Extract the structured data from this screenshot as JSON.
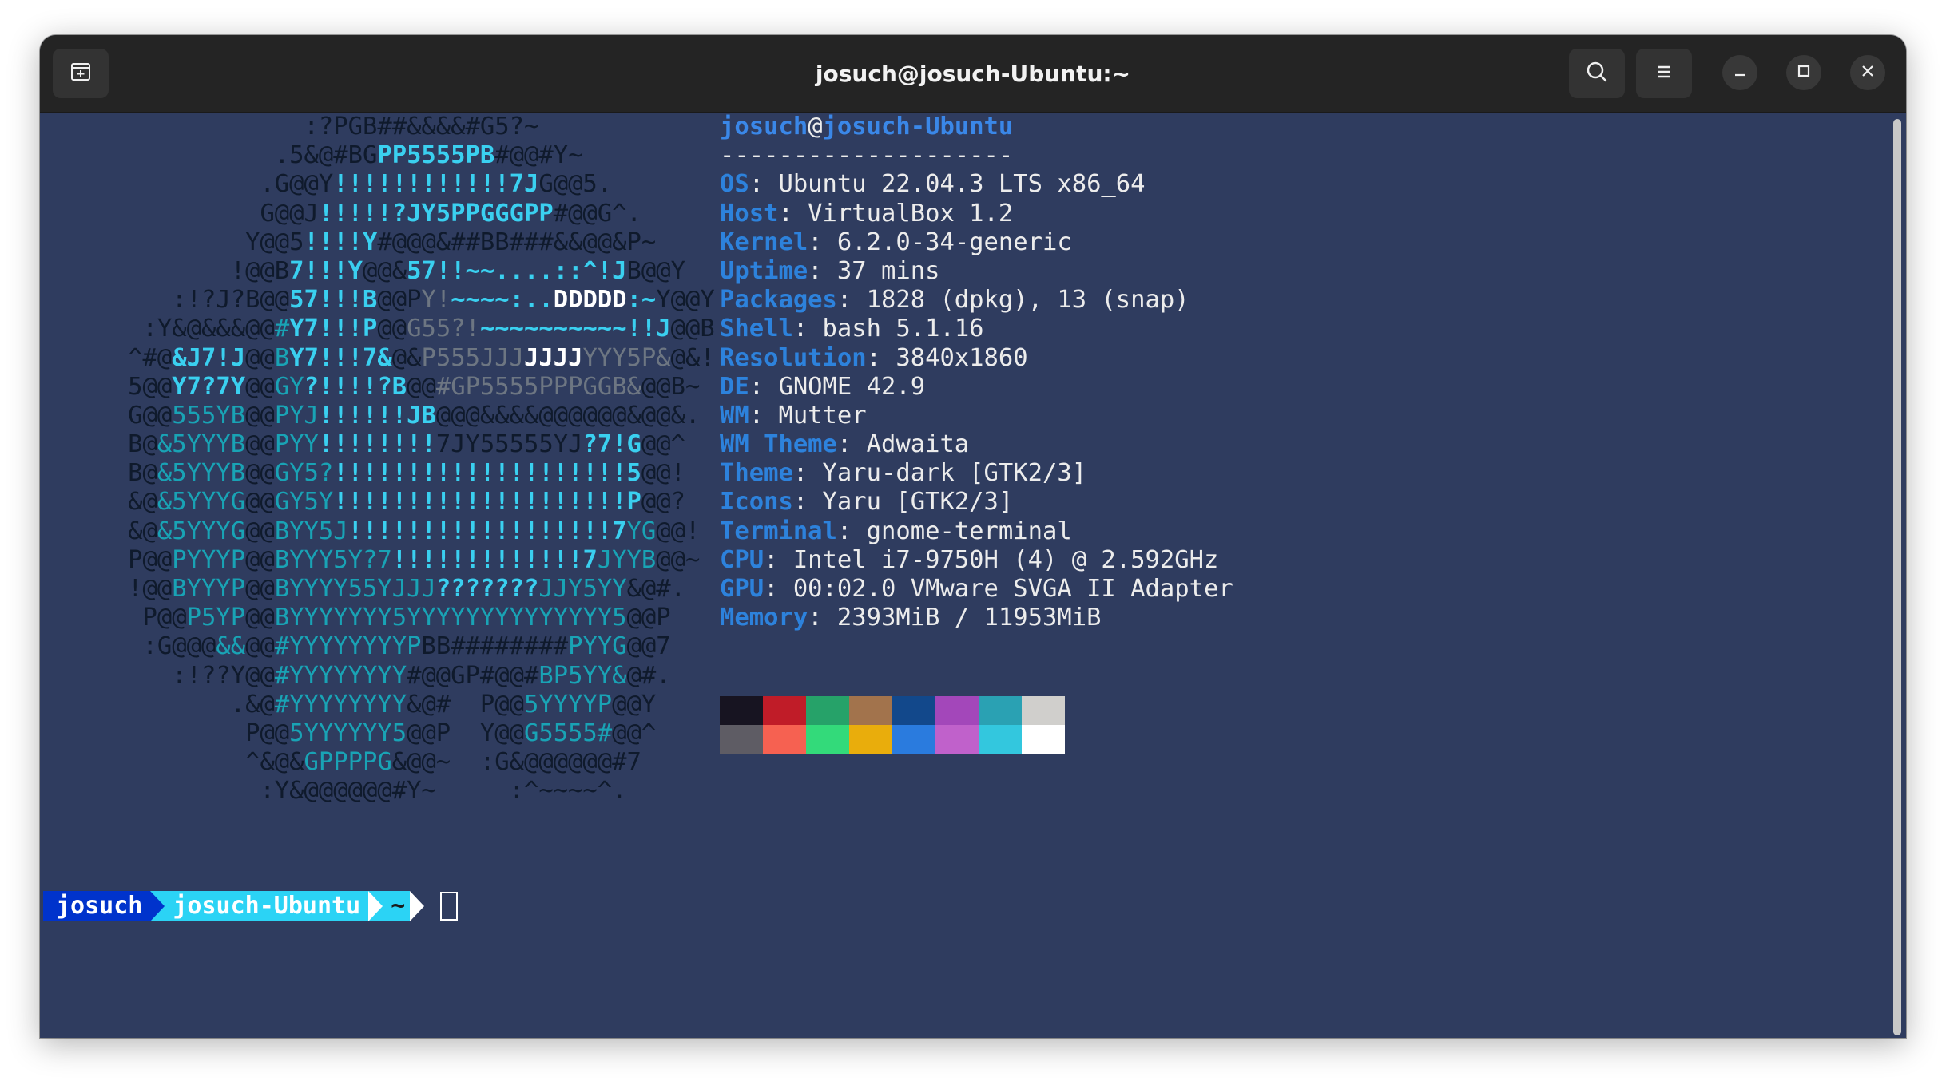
{
  "window": {
    "title": "josuch@josuch-Ubuntu:~",
    "buttons": {
      "new_tab_icon": "new-tab-icon",
      "search_icon": "search-icon",
      "menu_icon": "hamburger-menu-icon",
      "minimize_icon": "minimize-icon",
      "maximize_icon": "maximize-icon",
      "close_icon": "close-icon"
    }
  },
  "colors": {
    "terminal_bg": "#2f3c5f",
    "titlebar_bg": "#242424",
    "key_color": "#2d82dc",
    "art_cyan": "#3ad0f0",
    "art_teal": "#19a3b5"
  },
  "art": [
    [
      [
        "d",
        "                  :?PGB##&&&&#G5?~"
      ]
    ],
    [
      [
        "d",
        "                .5&@#BG"
      ],
      [
        "c",
        "PP5555PB"
      ],
      [
        "d",
        "#@@#Y~"
      ]
    ],
    [
      [
        "d",
        "               .G@@Y"
      ],
      [
        "c",
        "!!!!!!!!!!!!7J"
      ],
      [
        "d",
        "G@@5."
      ]
    ],
    [
      [
        "d",
        "               G@@J"
      ],
      [
        "c",
        "!!!!!?JY5PPGGGPP"
      ],
      [
        "d",
        "#@@G^."
      ]
    ],
    [
      [
        "d",
        "              Y@@5"
      ],
      [
        "c",
        "!!!!Y"
      ],
      [
        "d",
        "#@@@&##BB###&&@@&P~"
      ]
    ],
    [
      [
        "d",
        "             !@@B"
      ],
      [
        "c",
        "7!!!Y"
      ],
      [
        "d",
        "@@&"
      ],
      [
        "c",
        "57!!~~....::^!J"
      ],
      [
        "d",
        "B@@Y"
      ]
    ],
    [
      [
        "d",
        "         :!?J?B@@"
      ],
      [
        "c",
        "57!!!B"
      ],
      [
        "d",
        "@@P"
      ],
      [
        "g",
        "Y!"
      ],
      [
        "c",
        "~~~~:.."
      ],
      [
        "w",
        "DDDDD"
      ],
      [
        "c",
        ":~"
      ],
      [
        "d",
        "Y@@Y"
      ]
    ],
    [
      [
        "d",
        "       :Y&@&&&@@"
      ],
      [
        "t",
        "#"
      ],
      [
        "c",
        "Y7!!!P"
      ],
      [
        "d",
        "@@"
      ],
      [
        "g",
        "G55?!"
      ],
      [
        "c",
        "~~~~~~~~~~!!J"
      ],
      [
        "d",
        "@@B"
      ]
    ],
    [
      [
        "d",
        "      ^#@"
      ],
      [
        "c",
        "&J7!J"
      ],
      [
        "d",
        "@@"
      ],
      [
        "t",
        "B"
      ],
      [
        "c",
        "Y7!!!7&"
      ],
      [
        "d",
        "@&"
      ],
      [
        "g",
        "P555JJJ"
      ],
      [
        "w",
        "JJJJ"
      ],
      [
        "g",
        "YYY5P&"
      ],
      [
        "d",
        "@&!"
      ]
    ],
    [
      [
        "d",
        "      5@@"
      ],
      [
        "c",
        "Y7?7Y"
      ],
      [
        "d",
        "@@"
      ],
      [
        "t",
        "GY"
      ],
      [
        "c",
        "?!!!!?B"
      ],
      [
        "d",
        "@@"
      ],
      [
        "g",
        "#GP5555PPPGGB&"
      ],
      [
        "d",
        "@@B~"
      ]
    ],
    [
      [
        "d",
        "      G@@"
      ],
      [
        "t",
        "555YB"
      ],
      [
        "d",
        "@@"
      ],
      [
        "t",
        "PYJ"
      ],
      [
        "c",
        "!!!!!!JB"
      ],
      [
        "d",
        "@@@&&&&@@@@@@&@@&."
      ]
    ],
    [
      [
        "d",
        "      B@"
      ],
      [
        "t",
        "&5YYYB"
      ],
      [
        "d",
        "@@"
      ],
      [
        "t",
        "PYY"
      ],
      [
        "c",
        "!!!!!!!!"
      ],
      [
        "d",
        "7JY55555YJ"
      ],
      [
        "c",
        "?7!G"
      ],
      [
        "d",
        "@@^"
      ]
    ],
    [
      [
        "d",
        "      B@"
      ],
      [
        "t",
        "&5YYYB"
      ],
      [
        "d",
        "@@"
      ],
      [
        "t",
        "GY5?"
      ],
      [
        "c",
        "!!!!!!!!!!!!!!!!!!!!5"
      ],
      [
        "d",
        "@@!"
      ]
    ],
    [
      [
        "d",
        "      &@"
      ],
      [
        "t",
        "&5YYYG"
      ],
      [
        "d",
        "@@"
      ],
      [
        "t",
        "GY5Y"
      ],
      [
        "c",
        "!!!!!!!!!!!!!!!!!!!!P"
      ],
      [
        "d",
        "@@?"
      ]
    ],
    [
      [
        "d",
        "      &@"
      ],
      [
        "t",
        "&5YYYG"
      ],
      [
        "d",
        "@@"
      ],
      [
        "t",
        "BYY5J"
      ],
      [
        "c",
        "!!!!!!!!!!!!!!!!!!7"
      ],
      [
        "t",
        "YG"
      ],
      [
        "d",
        "@@!"
      ]
    ],
    [
      [
        "d",
        "      P@@"
      ],
      [
        "t",
        "PYYYP"
      ],
      [
        "d",
        "@@"
      ],
      [
        "t",
        "BYYY5Y?7"
      ],
      [
        "c",
        "!!!!!!!!!!!!!7"
      ],
      [
        "t",
        "JYYB"
      ],
      [
        "d",
        "@@~"
      ]
    ],
    [
      [
        "d",
        "      !@@"
      ],
      [
        "t",
        "BYYYP"
      ],
      [
        "d",
        "@@"
      ],
      [
        "t",
        "BYYYY55YJJJ"
      ],
      [
        "c",
        "???????"
      ],
      [
        "t",
        "JJY5YY"
      ],
      [
        "d",
        "&@#."
      ]
    ],
    [
      [
        "d",
        "       P@@"
      ],
      [
        "t",
        "P5YP"
      ],
      [
        "d",
        "@@"
      ],
      [
        "t",
        "BYYYYYYY5YYYYYYYYYYYYYY5"
      ],
      [
        "d",
        "@@P"
      ]
    ],
    [
      [
        "d",
        "       :G@@@"
      ],
      [
        "t",
        "&&"
      ],
      [
        "d",
        "@@"
      ],
      [
        "t",
        "#YYYYYYYYP"
      ],
      [
        "d",
        "BB########"
      ],
      [
        "t",
        "PYYG"
      ],
      [
        "d",
        "@@7"
      ]
    ],
    [
      [
        "d",
        "         :!??Y@@"
      ],
      [
        "t",
        "#YYYYYYYY"
      ],
      [
        "d",
        "#@@GP#@@#"
      ],
      [
        "t",
        "BP5YY&"
      ],
      [
        "d",
        "@#."
      ]
    ],
    [
      [
        "d",
        "             .&@"
      ],
      [
        "t",
        "#YYYYYYYY"
      ],
      [
        "d",
        "&@#  P@@"
      ],
      [
        "t",
        "5YYYYP"
      ],
      [
        "d",
        "@@Y"
      ]
    ],
    [
      [
        "d",
        "              P@@"
      ],
      [
        "t",
        "5YYYYYY5"
      ],
      [
        "d",
        "@@P  Y@@"
      ],
      [
        "t",
        "G5555#"
      ],
      [
        "d",
        "@@^"
      ]
    ],
    [
      [
        "d",
        "              ^&@&"
      ],
      [
        "t",
        "GPPPPG"
      ],
      [
        "d",
        "&@@~  :G&@@@@@@#7"
      ]
    ],
    [
      [
        "d",
        "               :Y&@@@@@@#Y~     :^~~~~^."
      ]
    ]
  ],
  "sysinfo": {
    "user": "josuch",
    "at": "@",
    "host": "josuch-Ubuntu",
    "separator": "--------------------",
    "rows": [
      {
        "key": "OS",
        "value": ": Ubuntu 22.04.3 LTS x86_64"
      },
      {
        "key": "Host",
        "value": ": VirtualBox 1.2"
      },
      {
        "key": "Kernel",
        "value": ": 6.2.0-34-generic"
      },
      {
        "key": "Uptime",
        "value": ": 37 mins"
      },
      {
        "key": "Packages",
        "value": ": 1828 (dpkg), 13 (snap)"
      },
      {
        "key": "Shell",
        "value": ": bash 5.1.16"
      },
      {
        "key": "Resolution",
        "value": ": 3840x1860"
      },
      {
        "key": "DE",
        "value": ": GNOME 42.9"
      },
      {
        "key": "WM",
        "value": ": Mutter"
      },
      {
        "key": "WM Theme",
        "value": ": Adwaita"
      },
      {
        "key": "Theme",
        "value": ": Yaru-dark [GTK2/3]"
      },
      {
        "key": "Icons",
        "value": ": Yaru [GTK2/3]"
      },
      {
        "key": "Terminal",
        "value": ": gnome-terminal"
      },
      {
        "key": "CPU",
        "value": ": Intel i7-9750H (4) @ 2.592GHz"
      },
      {
        "key": "GPU",
        "value": ": 00:02.0 VMware SVGA II Adapter"
      },
      {
        "key": "Memory",
        "value": ": 2393MiB / 11953MiB"
      }
    ]
  },
  "palette": [
    "#171421",
    "#c01c28",
    "#26a269",
    "#a2734c",
    "#12488b",
    "#a347ba",
    "#2aa1b3",
    "#d0cfcc",
    "#5e5c64",
    "#f66151",
    "#33da7a",
    "#e9ad0c",
    "#2a7bde",
    "#c061cb",
    "#33c7de",
    "#ffffff"
  ],
  "prompt": {
    "user": "josuch",
    "host": "josuch-Ubuntu",
    "dir": "~"
  }
}
